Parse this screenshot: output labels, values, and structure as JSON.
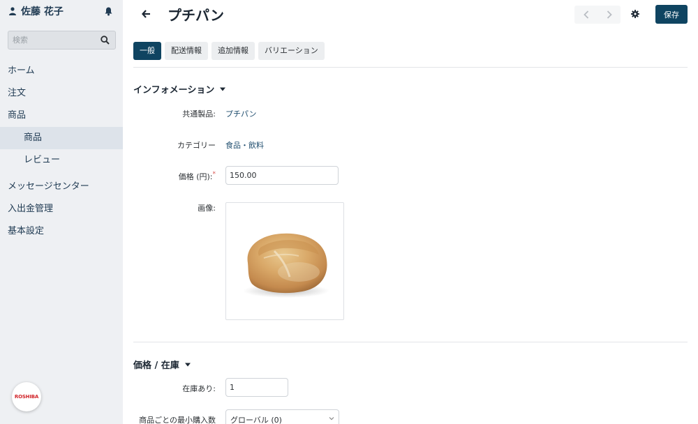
{
  "sidebar": {
    "user_name": "佐藤 花子",
    "search_placeholder": "検索",
    "items": [
      {
        "label": "ホーム"
      },
      {
        "label": "注文"
      },
      {
        "label": "商品"
      },
      {
        "label": "商品"
      },
      {
        "label": "レビュー"
      },
      {
        "label": "メッセージセンター"
      },
      {
        "label": "入出金管理"
      },
      {
        "label": "基本設定"
      }
    ],
    "logo_text": "ROSHIBA"
  },
  "header": {
    "title": "プチパン",
    "save_label": "保存"
  },
  "tabs": [
    {
      "label": "一般"
    },
    {
      "label": "配送情報"
    },
    {
      "label": "追加情報"
    },
    {
      "label": "バリエーション"
    }
  ],
  "info_section": {
    "title": "インフォメーション",
    "common_product_label": "共通製品:",
    "common_product_value": "プチパン",
    "category_label": "カテゴリー",
    "category_value": "食品・飲料",
    "price_label": "価格 (円):",
    "price_required": "*",
    "price_value": "150.00",
    "image_label": "画像:"
  },
  "stock_section": {
    "title": "価格 / 在庫",
    "in_stock_label": "在庫あり:",
    "in_stock_value": "1",
    "min_qty_label": "商品ごとの最小購入数",
    "min_qty_value": "グローバル (0)"
  },
  "colors": {
    "primary": "#0f4461",
    "sidebar_bg": "#eef0f3",
    "link": "#1f4d6e",
    "required": "#d9534f"
  }
}
